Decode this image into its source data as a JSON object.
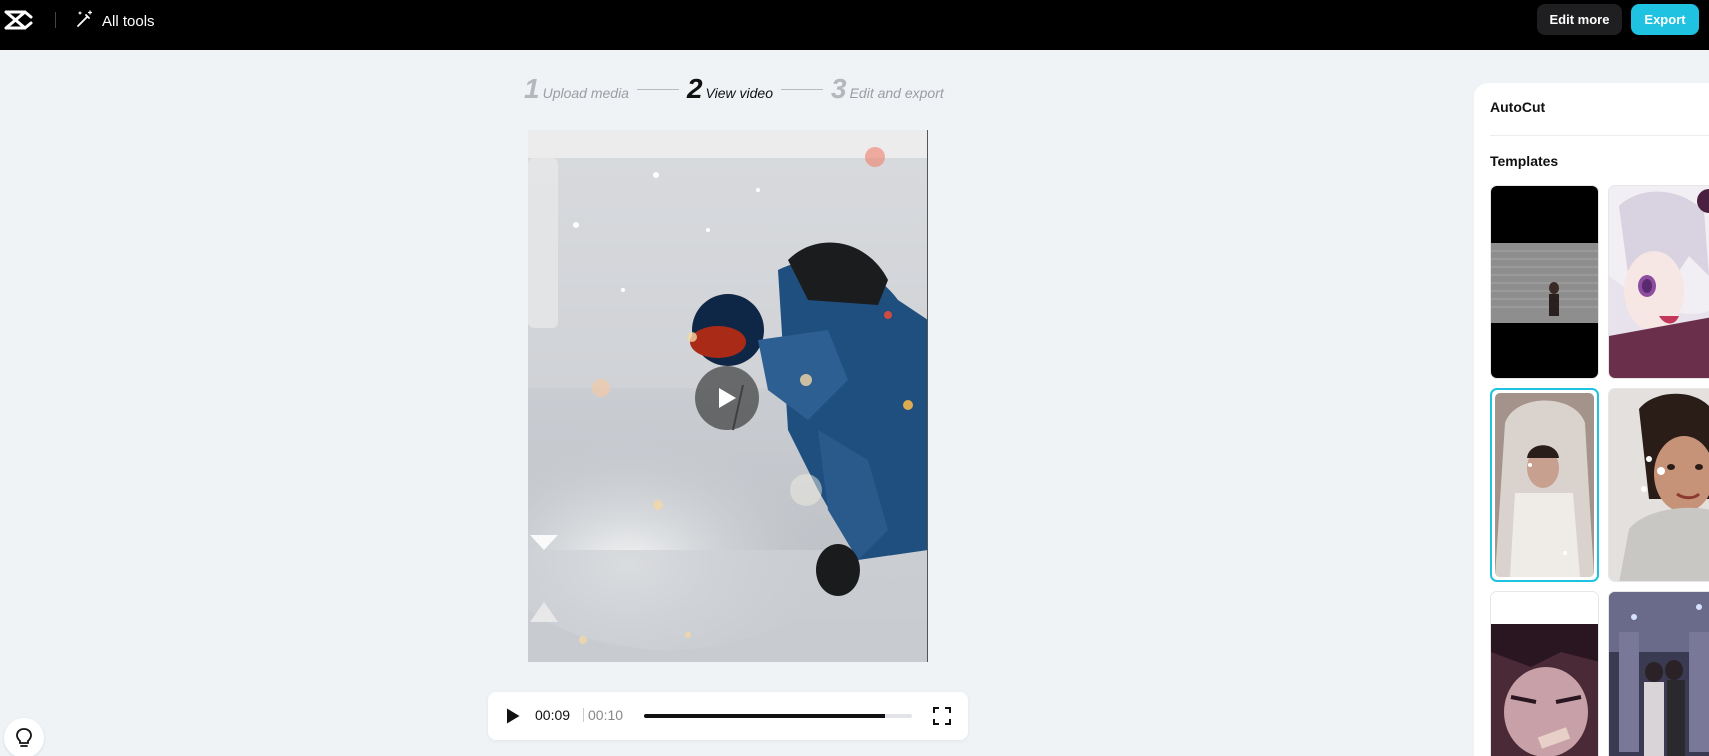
{
  "header": {
    "logo_icon": "capcut-logo-icon",
    "all_tools_label": "All tools",
    "edit_more_label": "Edit more",
    "export_label": "Export",
    "accent_color": "#1fc2e0"
  },
  "stepper": {
    "steps": [
      {
        "num": "1",
        "label": "Upload media",
        "state": "done"
      },
      {
        "num": "2",
        "label": "View video",
        "state": "active"
      },
      {
        "num": "3",
        "label": "Edit and export",
        "state": "pending"
      }
    ]
  },
  "player": {
    "current_time": "00:09",
    "duration": "00:10",
    "progress_fraction": 0.9
  },
  "panel": {
    "title": "AutoCut",
    "templates_title": "Templates",
    "selected_template_index": 2
  }
}
